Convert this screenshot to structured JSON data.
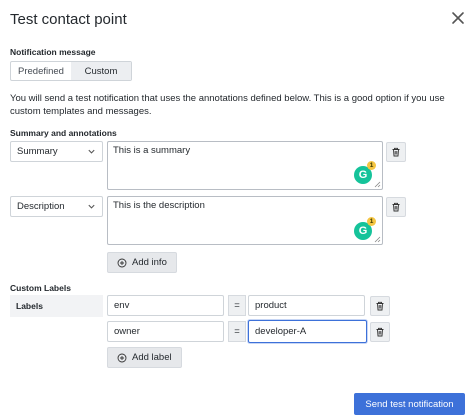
{
  "dialog": {
    "title": "Test contact point"
  },
  "notification": {
    "label": "Notification message",
    "options": [
      "Predefined",
      "Custom"
    ],
    "selected": "Custom",
    "description": "You will send a test notification that uses the annotations defined below. This is a good option if you use custom templates and messages."
  },
  "annotations": {
    "label": "Summary and annotations",
    "rows": [
      {
        "key": "Summary",
        "value": "This is a summary",
        "badge_count": "1"
      },
      {
        "key": "Description",
        "value": "This is the description",
        "badge_count": "1"
      }
    ],
    "add_label": "Add info"
  },
  "custom_labels": {
    "label": "Custom Labels",
    "column_label": "Labels",
    "equals": "=",
    "rows": [
      {
        "key": "env",
        "value": "product"
      },
      {
        "key": "owner",
        "value": "developer-A"
      }
    ],
    "add_label": "Add label"
  },
  "footer": {
    "send_label": "Send test notification"
  },
  "colors": {
    "primary": "#3d71d9",
    "grammarly": "#15c39a"
  },
  "icons": {
    "close": "close-icon",
    "trash": "trash-icon",
    "plus": "plus-circle-icon",
    "chevron": "chevron-down-icon"
  }
}
